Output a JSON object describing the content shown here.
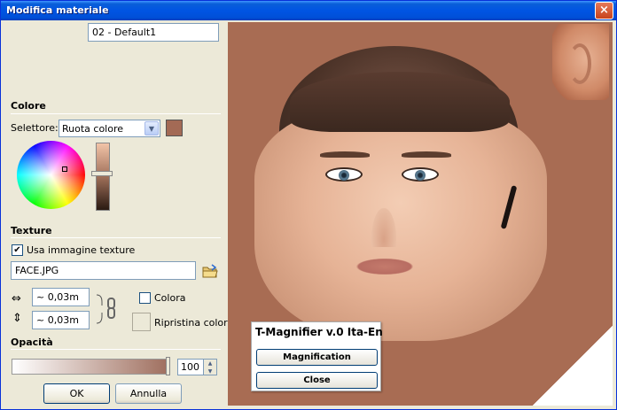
{
  "window": {
    "title": "Modifica materiale",
    "close_glyph": "×"
  },
  "material": {
    "name": "02 - Default1"
  },
  "color_section": {
    "header": "Colore",
    "selector_label": "Selettore:",
    "selector_value": "Ruota colore",
    "swatch_color": "#a36a55"
  },
  "texture_section": {
    "header": "Texture",
    "use_texture_label": "Usa immagine texture",
    "use_texture_checked": "✔",
    "filename": "FACE.JPG",
    "width_value": "~ 0,03m",
    "height_value": "~ 0,03m",
    "colora_label": "Colora",
    "ripristina_label": "Ripristina colore"
  },
  "opacity_section": {
    "header": "Opacità",
    "value": "100"
  },
  "buttons": {
    "ok": "OK",
    "cancel": "Annulla"
  },
  "magnifier": {
    "title": "T-Magnifier v.0 Ita-En",
    "magnification_label": "Magnification",
    "close_label": "Close"
  }
}
